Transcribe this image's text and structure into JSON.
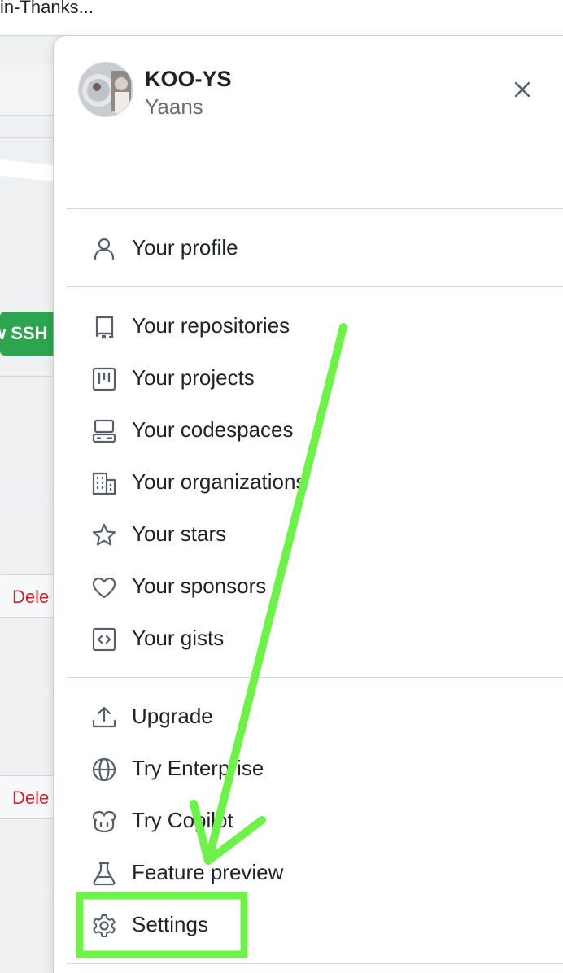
{
  "background": {
    "top_text": "in-Thanks...",
    "green_button_label": "w SSH",
    "delete_button_label": "Dele"
  },
  "drawer": {
    "username": "KOO-YS",
    "fullname": "Yaans",
    "close_icon": "x-icon",
    "groups": [
      [
        {
          "label": "Your profile",
          "icon": "person-icon"
        }
      ],
      [
        {
          "label": "Your repositories",
          "icon": "repo-icon"
        },
        {
          "label": "Your projects",
          "icon": "project-icon"
        },
        {
          "label": "Your codespaces",
          "icon": "codespaces-icon"
        },
        {
          "label": "Your organizations",
          "icon": "organization-icon"
        },
        {
          "label": "Your stars",
          "icon": "star-icon"
        },
        {
          "label": "Your sponsors",
          "icon": "heart-icon"
        },
        {
          "label": "Your gists",
          "icon": "code-square-icon"
        }
      ],
      [
        {
          "label": "Upgrade",
          "icon": "upload-icon"
        },
        {
          "label": "Try Enterprise",
          "icon": "globe-icon"
        },
        {
          "label": "Try Copilot",
          "icon": "copilot-icon"
        },
        {
          "label": "Feature preview",
          "icon": "beaker-icon"
        },
        {
          "label": "Settings",
          "icon": "gear-icon"
        }
      ]
    ]
  },
  "annotation": {
    "color": "#6ef24a"
  }
}
